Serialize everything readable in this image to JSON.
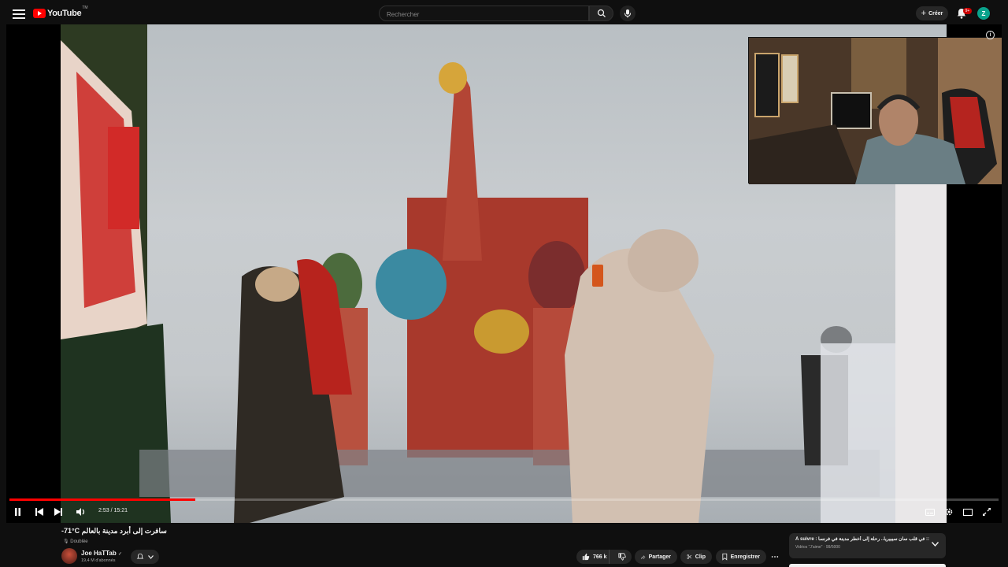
{
  "header": {
    "logo_text": "YouTube",
    "logo_tm": "TM",
    "search_placeholder": "Rechercher",
    "create_label": "Créer",
    "notification_count": "9+",
    "avatar_letter": "Z"
  },
  "player": {
    "time_display": "2:53 / 15:21",
    "progress_fraction": 0.188
  },
  "video": {
    "title": "-71°C سافرت إلى أبرد مدينة بالعالم",
    "dubbed_label": "Doublée",
    "channel_name": "Joe HaTTab",
    "verified_mark": "✓",
    "subscribers": "19,4 M d'abonnés"
  },
  "actions": {
    "like_count": "766 k",
    "share_label": "Partager",
    "clip_label": "Clip",
    "save_label": "Enregistrer",
    "more_label": "⋯"
  },
  "up_next": {
    "prefix": "À suivre",
    "title": "في قلب سان سيبيريا.. رحلة إلى أخطر مدينة في فرنسا ::",
    "meta": "Vidéos \"J'aime\" · 99/5000"
  },
  "colors": {
    "accent": "#ff0000",
    "background": "#0f0f0f",
    "pill": "#272727",
    "avatar": "#0aa38c"
  }
}
